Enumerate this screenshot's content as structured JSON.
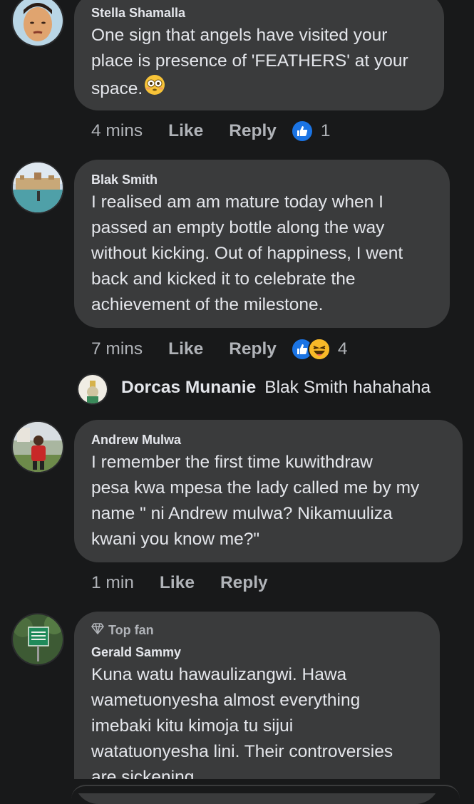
{
  "comments": [
    {
      "author": "Stella Shamalla",
      "text_lines": [
        "One sign that angels have visited your",
        "place is presence of 'FEATHERS' at your",
        "space."
      ],
      "time": "4 mins",
      "like_label": "Like",
      "reply_label": "Reply",
      "reaction_count": "1"
    },
    {
      "author": "Blak Smith",
      "text_lines": [
        "I realised am am mature today when I",
        "passed an empty bottle along the way",
        "without kicking. Out of happiness, I went",
        "back and kicked it to celebrate the",
        "achievement of the milestone."
      ],
      "time": "7 mins",
      "like_label": "Like",
      "reply_label": "Reply",
      "reaction_count": "4"
    },
    {
      "author": "Andrew Mulwa",
      "text_lines": [
        "I remember the first time kuwithdraw",
        "pesa kwa mpesa the lady called me by my",
        "name \" ni Andrew mulwa? Nikamuuliza",
        "kwani you know me?\""
      ],
      "time": "1 min",
      "like_label": "Like",
      "reply_label": "Reply"
    },
    {
      "badge": "Top fan",
      "author": "Gerald Sammy",
      "text_lines": [
        "Kuna watu hawaulizangwi. Hawa",
        "wametuonyesha almost everything",
        "imebaki kitu kimoja tu sijui",
        "watatuonyesha lini. Their controversies",
        "are sickening"
      ]
    }
  ],
  "reply": {
    "author": "Dorcas Munanie",
    "text": "Blak Smith hahahaha"
  },
  "colors": {
    "background": "#18191a",
    "bubble": "#3a3b3c",
    "primary_text": "#e4e6eb",
    "secondary_text": "#b0b3b8",
    "like_blue": "#1b74e4",
    "haha_yellow": "#f7b928"
  }
}
